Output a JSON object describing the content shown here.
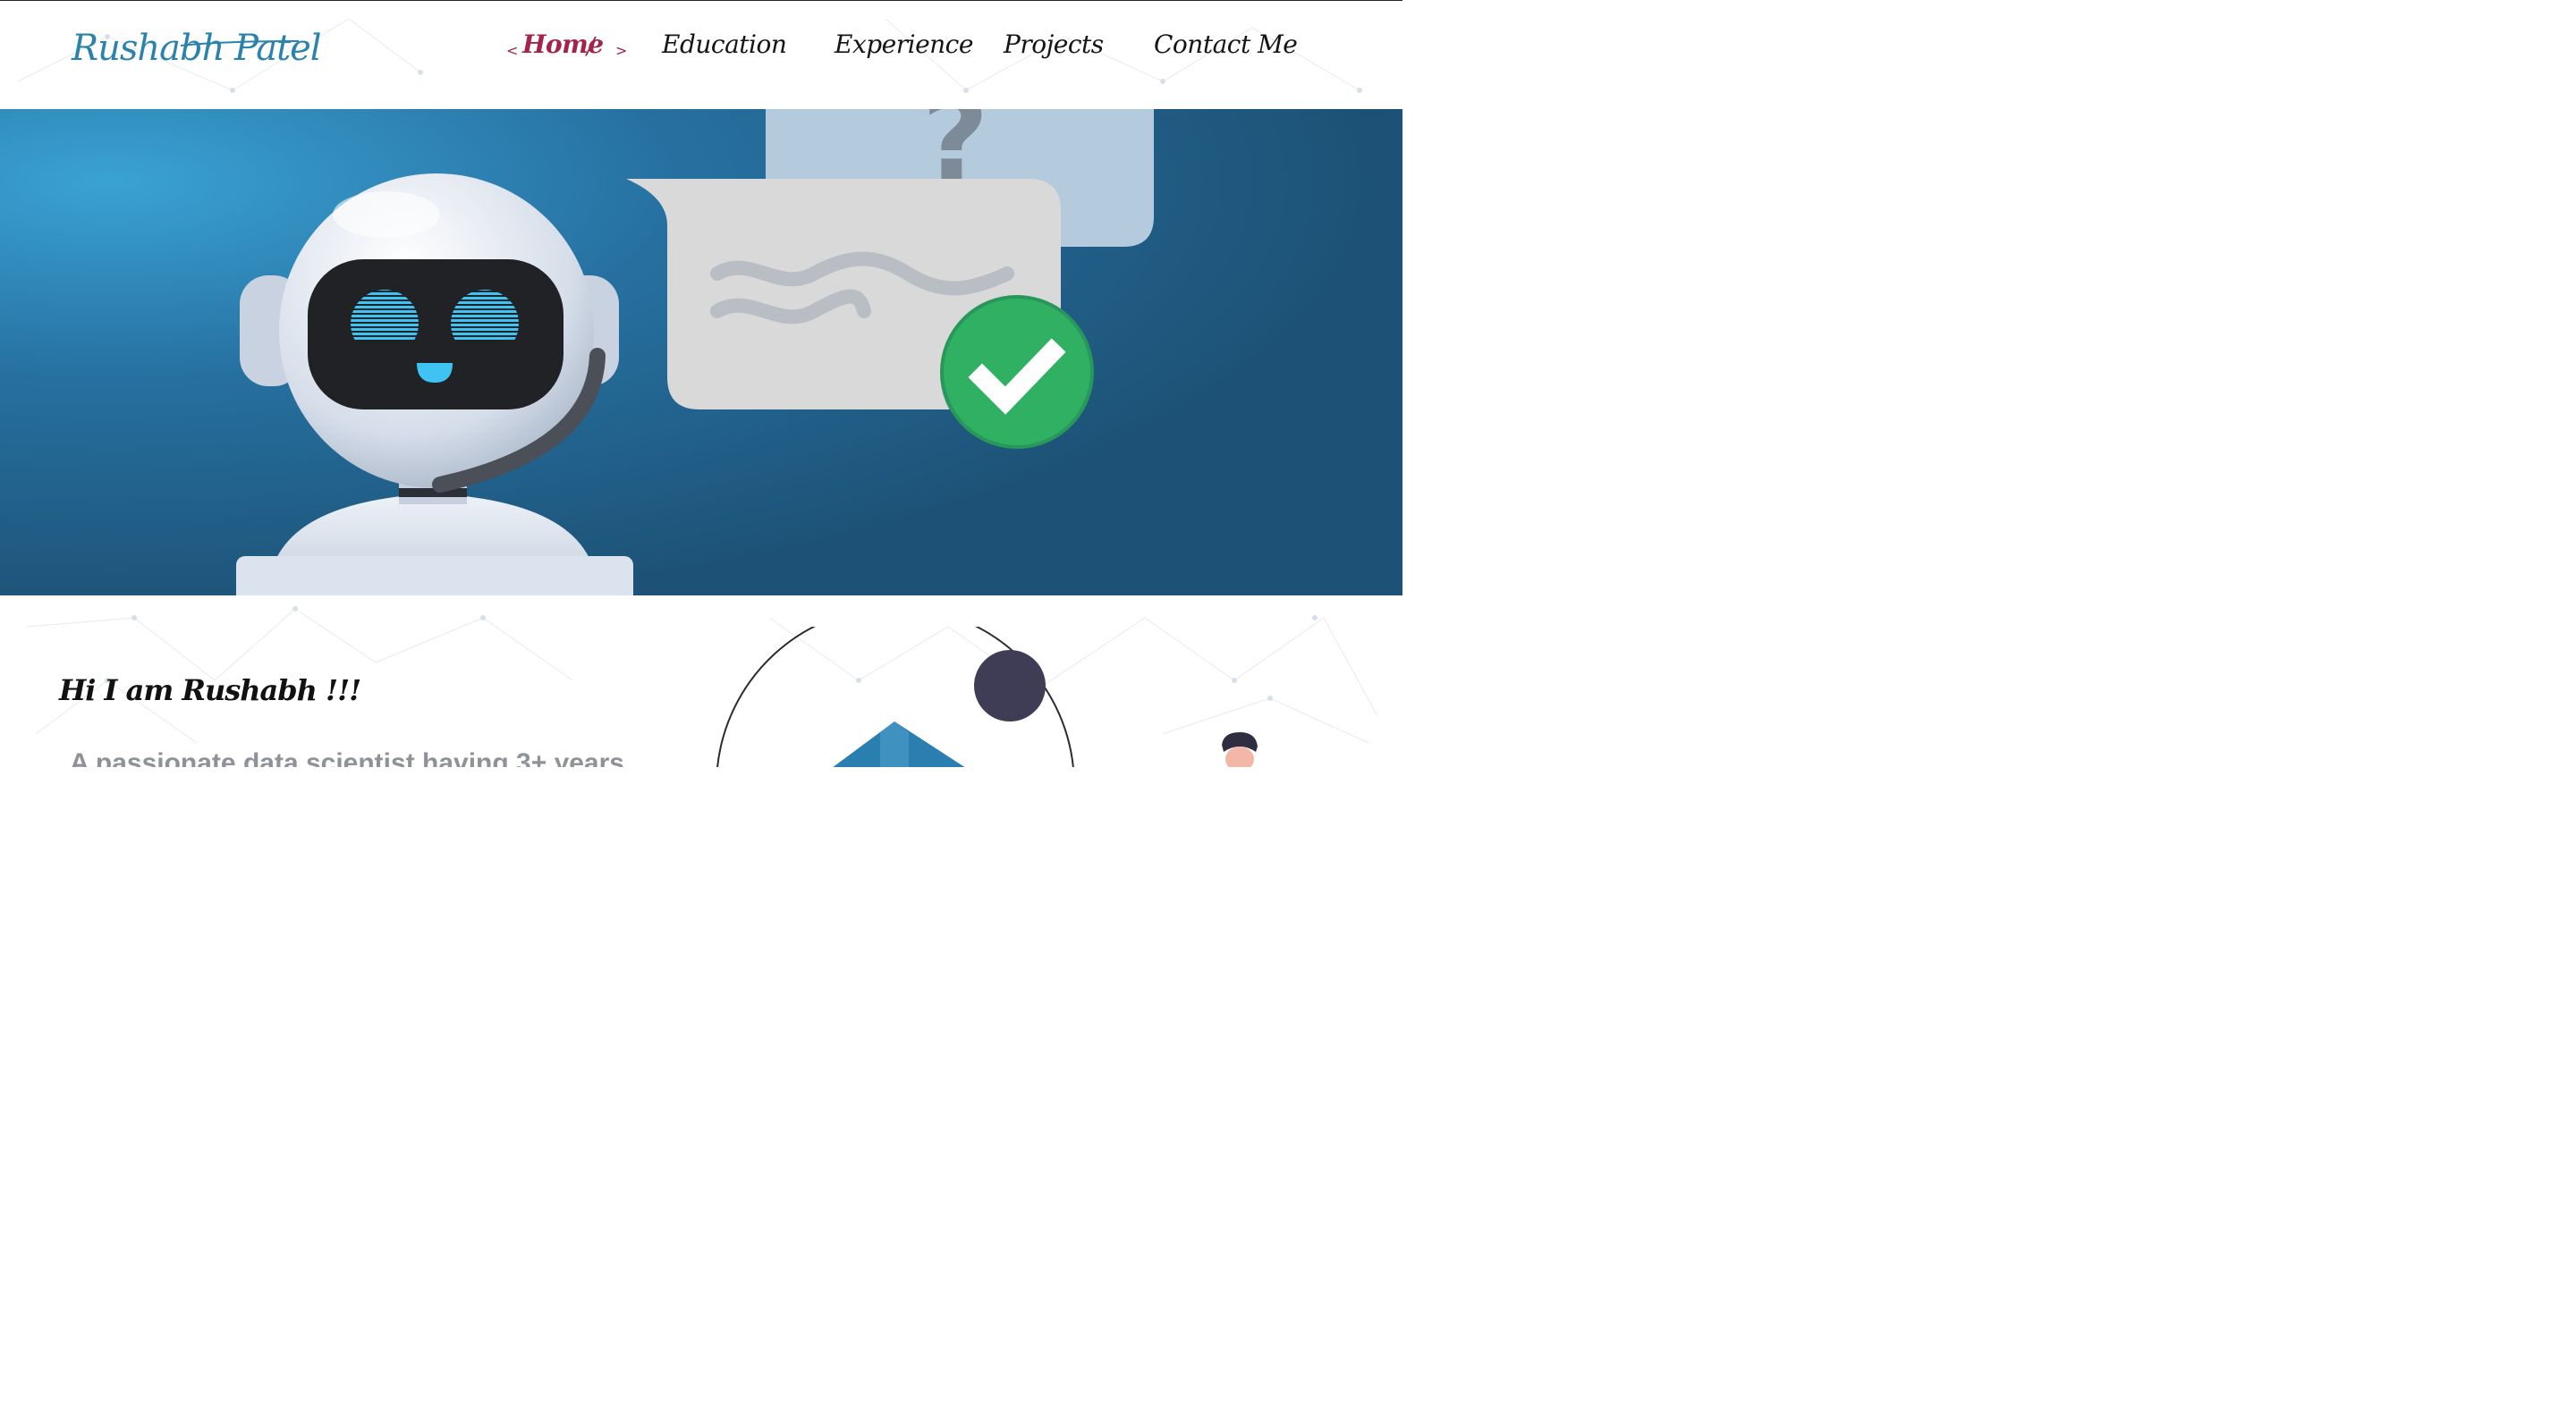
{
  "site": {
    "brand": "Rushabh Patel"
  },
  "nav": {
    "items": [
      {
        "label": "Home",
        "active": true
      },
      {
        "label": "Education",
        "active": false
      },
      {
        "label": "Experience",
        "active": false
      },
      {
        "label": "Projects",
        "active": false
      },
      {
        "label": "Contact Me",
        "active": false
      }
    ],
    "active_prefix": "<",
    "active_suffix": ">",
    "active_slash": "/"
  },
  "hero": {
    "question_mark": "?"
  },
  "intro": {
    "greeting": "Hi I am Rushabh !!!",
    "tagline": "A passionate data scientist having 3+ years"
  },
  "colors": {
    "brand": "#2a82ad",
    "active_nav": "#a3234b",
    "hero_bg": "#23608a",
    "check_green": "#2fb063"
  }
}
